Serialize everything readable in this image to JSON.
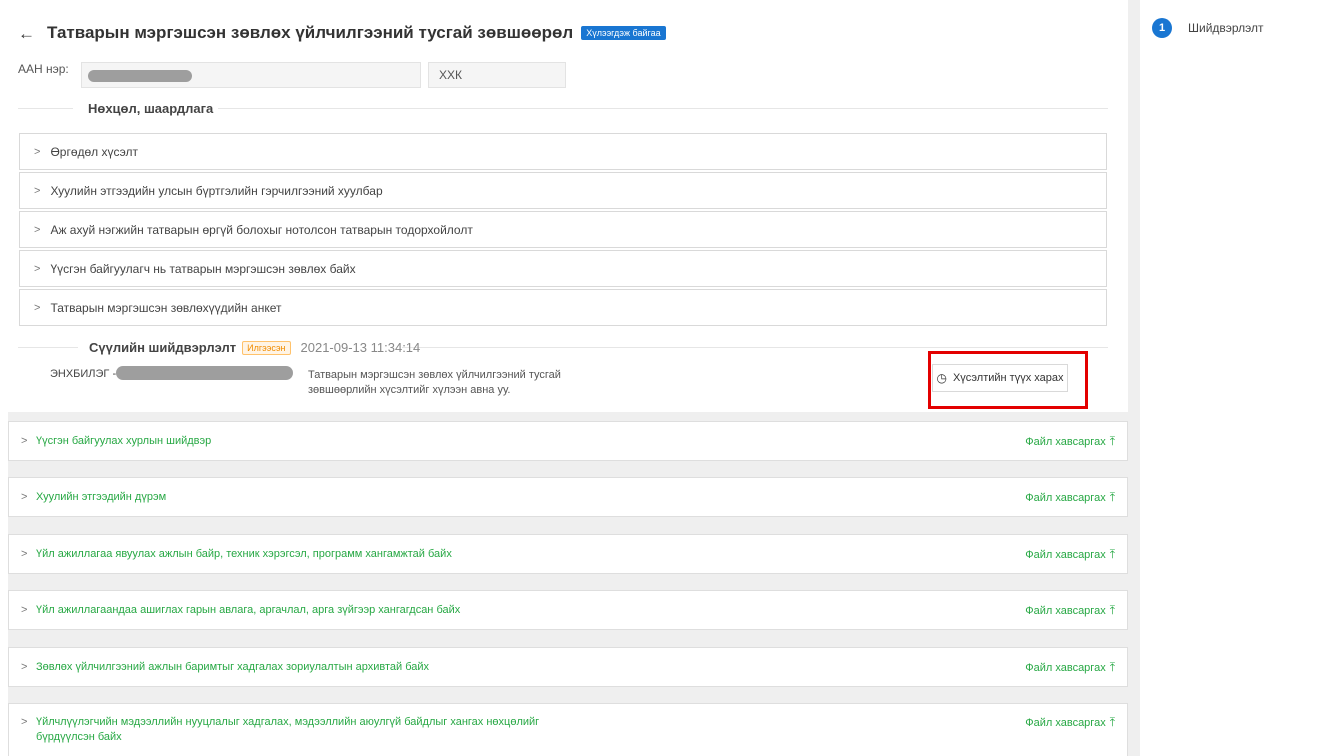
{
  "header": {
    "back_icon": "arrow-left-icon",
    "title": "Татварын мэргэшсэн зөвлөх үйлчилгээний тусгай зөвшөөрөл",
    "status_badge": "Хүлээгдэж байгаа"
  },
  "entity": {
    "label": "ААН нэр:",
    "type_value": "ХХК"
  },
  "requirements": {
    "title": "Нөхцөл, шаардлага",
    "items": [
      "Өргөдөл хүсэлт",
      "Хуулийн этгээдийн улсын бүртгэлийн гэрчилгээний хуулбар",
      "Аж ахуй нэгжийн татварын өргүй болохыг нотолсон татварын тодорхойлолт",
      "Үүсгэн байгуулагч нь татварын мэргэшсэн зөвлөх байх",
      "Татварын мэргэшсэн зөвлөхүүдийн анкет"
    ]
  },
  "decision": {
    "title": "Сүүлийн шийдвэрлэлт",
    "status_badge": "Илгээсэн",
    "datetime": "2021-09-13 11:34:14",
    "user": "ЭНХБИЛЭГ -",
    "comment": "Татварын мэргэшсэн зөвлөх үйлчилгээний тусгай зөвшөөрлийн хүсэлтийг хүлээн авна уу.",
    "history_button": "Хүсэлтийн түүх харах",
    "history_icon": "clock-icon"
  },
  "uploads": {
    "action_label": "Файл хавсаргах",
    "action_icon": "upload-icon",
    "items": [
      "Үүсгэн байгуулах хурлын шийдвэр",
      "Хуулийн этгээдийн дүрэм",
      "Үйл ажиллагаа явуулах ажлын байр, техник хэрэгсэл, программ хангамжтай байх",
      "Үйл ажиллагаандаа ашиглах гарын авлага, аргачлал, арга зүйгээр хангагдсан байх",
      "Зөвлөх үйлчилгээний ажлын баримтыг хадгалах зориулалтын архивтай байх",
      "Үйлчлүүлэгчийн мэдээллийн нууцлалыг хадгалах, мэдээллийн аюулгүй байдлыг хангах нөхцөлийг бүрдүүлсэн байх"
    ]
  },
  "sidebar": {
    "step_number": "1",
    "step_label": "Шийдвэрлэлт"
  },
  "colors": {
    "accent": "#1976d2",
    "success": "#27a844",
    "warning": "#f08c00",
    "highlight": "#e30000"
  }
}
